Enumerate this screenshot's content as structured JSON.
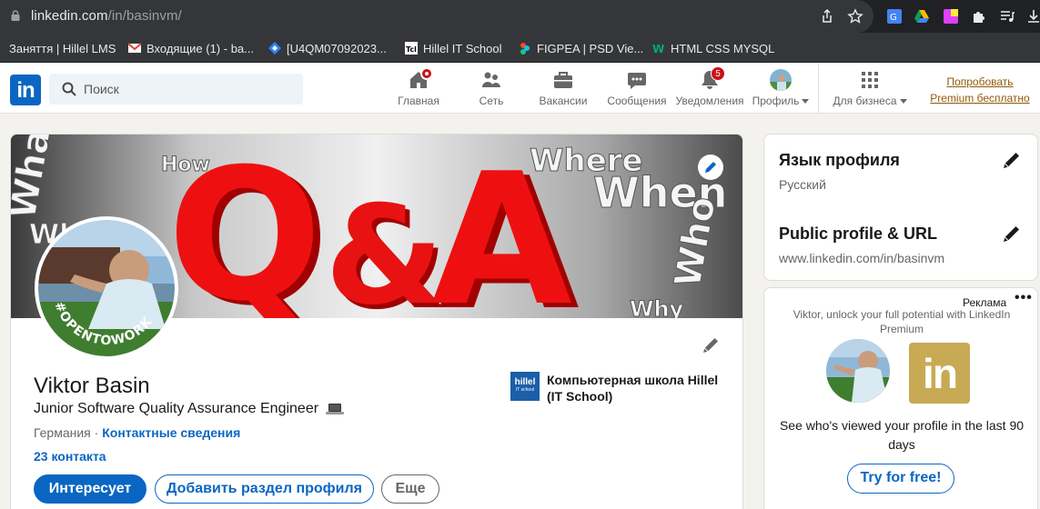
{
  "browser": {
    "url_host": "linkedin.com",
    "url_path": "/in/basinvm/",
    "bookmarks": [
      {
        "label": "Заняття | Hillel LMS"
      },
      {
        "label": "Входящие (1) - ba..."
      },
      {
        "label": "[U4QM07092023..."
      },
      {
        "label": "Hillel IT School"
      },
      {
        "label": "FIGPEA | PSD Vie..."
      },
      {
        "label": "HTML CSS MYSQL"
      }
    ]
  },
  "nav": {
    "search_placeholder": "Поиск",
    "items": [
      {
        "label": "Главная",
        "icon": "home-icon"
      },
      {
        "label": "Сеть",
        "icon": "network-icon"
      },
      {
        "label": "Вакансии",
        "icon": "briefcase-icon"
      },
      {
        "label": "Сообщения",
        "icon": "messaging-icon"
      },
      {
        "label": "Уведомления",
        "icon": "bell-icon",
        "badge": "5"
      },
      {
        "label": "Профиль",
        "icon": "avatar-icon"
      },
      {
        "label": "Для бизнеса",
        "icon": "grid-icon"
      }
    ],
    "premium_line1": "Попробовать",
    "premium_line2": "Premium бесплатно"
  },
  "profile": {
    "name": "Viktor Basin",
    "headline": "Junior Software Quality Assurance Engineer",
    "location": "Германия",
    "separator": "·",
    "contact_link": "Контактные сведения",
    "connections": "23 контакта",
    "open_to_work": "#OPENTOWORK",
    "banner_text": "Q&A",
    "school": "Компьютерная школа Hillel (IT School)",
    "school_logo_text": "hillel",
    "school_logo_sub": "IT school",
    "buttons": {
      "primary": "Интересует",
      "add_section": "Добавить раздел профиля",
      "more": "Еще"
    }
  },
  "sidebar": {
    "language_title": "Язык профиля",
    "language_value": "Русский",
    "public_title": "Public profile & URL",
    "public_value": "www.linkedin.com/in/basinvm"
  },
  "ad": {
    "label": "Реклама",
    "more": "•••",
    "text": "Viktor, unlock your full potential with LinkedIn Premium",
    "in_logo": "in",
    "cta": "See who's viewed your profile in the last 90 days",
    "button": "Try for free!"
  },
  "colors": {
    "linkedin_blue": "#0a66c2",
    "premium_gold": "#915907",
    "badge_red": "#cc1016"
  }
}
